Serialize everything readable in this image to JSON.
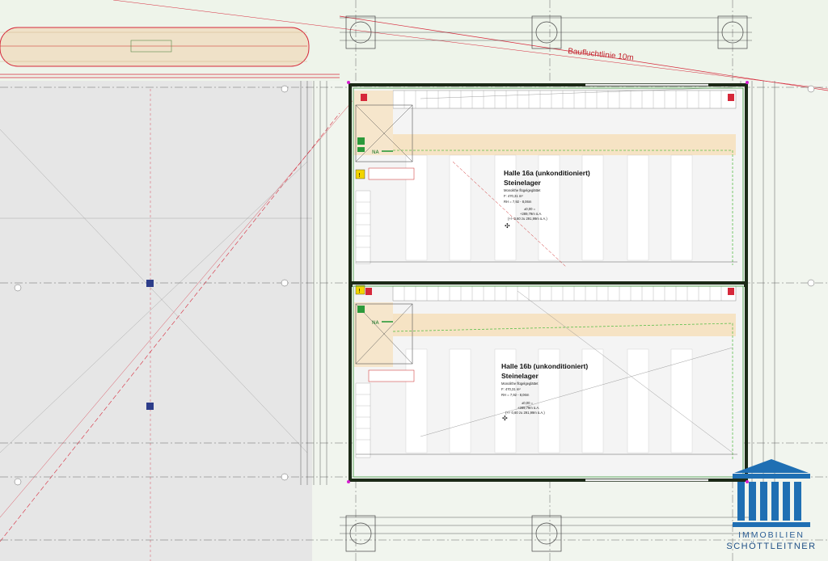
{
  "hall_a": {
    "title": "Halle 16a (unkonditioniert)",
    "use": "Steinelager",
    "floor": "Monolithe flügelgeglättet",
    "area": "F: 470,31 m²",
    "height": "RH = 7,92 - 8,06m",
    "level1": "±0,00 =",
    "level2": "+289,79m ü.A.",
    "level3": "(+/- 0,60 zu 291,99m ü.A.)"
  },
  "hall_b": {
    "title": "Halle 16b (unkonditioniert)",
    "use": "Steinelager",
    "floor": "Monolithe flügelgeglättet",
    "area": "F: 470,31 m²",
    "height": "RH = 7,92 - 8,06m",
    "level1": "±0,00 =",
    "level2": "+289,79m ü.A.",
    "level3": "(+/- 0,60 zu 291,99m ü.A.)"
  },
  "baufluchtlinie": "Baufluchtlinie 10m",
  "na_label": "NA",
  "logo": {
    "line1": "IMMOBILIEN",
    "line2": "SCHÖTTLEITNER"
  },
  "colors": {
    "wall": "#1c2a17",
    "wall_green": "#3d9a3a",
    "aisle": "#f6e3c4",
    "red_line": "#d6283a",
    "logo_blue": "#1f6fb3"
  },
  "icons": [
    "exit-sign-icon",
    "fire-extinguisher-icon",
    "logo-building-icon"
  ]
}
